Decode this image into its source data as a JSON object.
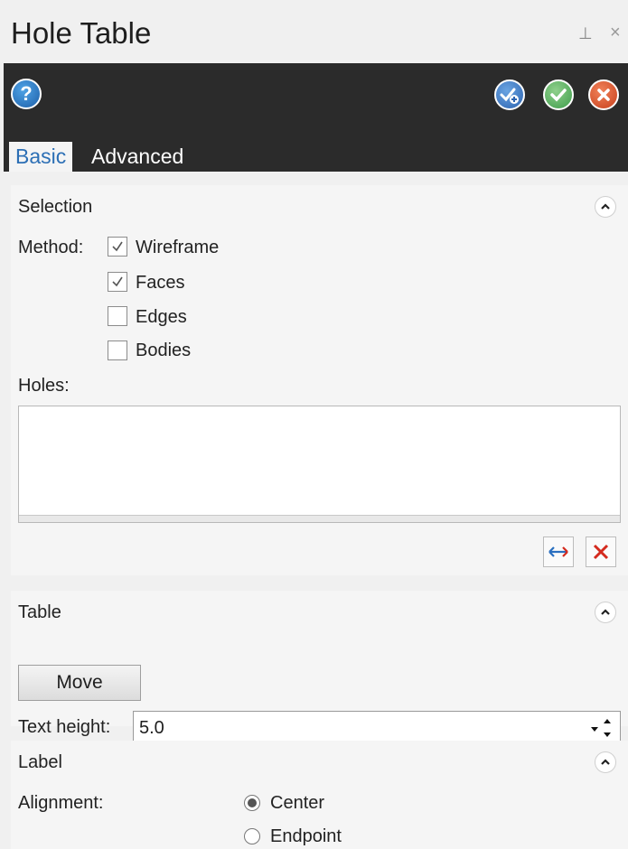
{
  "window": {
    "title": "Hole Table",
    "pin_glyph": "⊥",
    "close_glyph": "×"
  },
  "toolbar": {
    "help_glyph": "?",
    "apply_icon": "apply-plus-icon",
    "ok_icon": "ok-check-icon",
    "cancel_icon": "cancel-x-icon"
  },
  "tabs": [
    {
      "label": "Basic",
      "selected": true
    },
    {
      "label": "Advanced",
      "selected": false
    }
  ],
  "selection": {
    "header": "Selection",
    "method_label": "Method:",
    "methods": [
      {
        "label": "Wireframe",
        "checked": true
      },
      {
        "label": "Faces",
        "checked": true
      },
      {
        "label": "Edges",
        "checked": false
      },
      {
        "label": "Bodies",
        "checked": false
      }
    ],
    "holes_label": "Holes:",
    "holes": []
  },
  "table": {
    "header": "Table",
    "move_label": "Move",
    "text_height_label": "Text height:",
    "text_height_value": "5.0"
  },
  "label": {
    "header": "Label",
    "alignment_label": "Alignment:",
    "options": [
      {
        "label": "Center",
        "selected": true
      },
      {
        "label": "Endpoint",
        "selected": false
      }
    ]
  },
  "colors": {
    "toolbar_bg": "#2b2b2b",
    "tab_selected_text": "#2c6fb5",
    "reverse_arrow": "#2a6fc0",
    "remove_x": "#d42a1e"
  }
}
